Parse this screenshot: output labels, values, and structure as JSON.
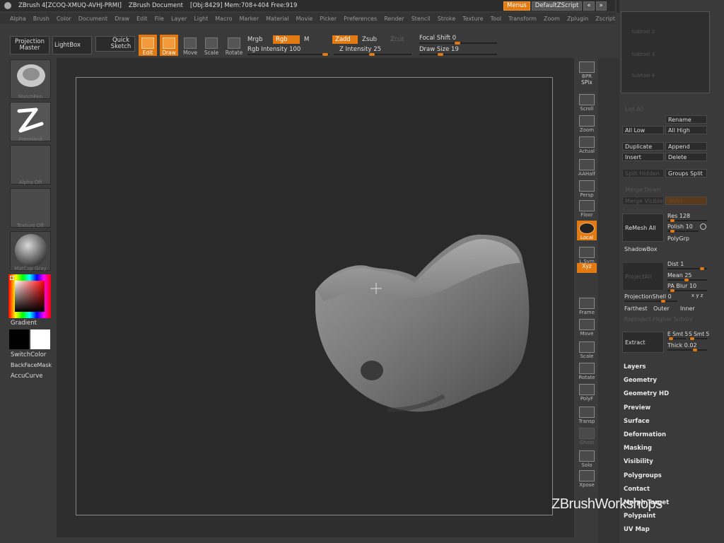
{
  "titlebar": {
    "app_title": "ZBrush 4[ZCOQ-XMUQ-AVHJ-PRMI]",
    "doc_title": "ZBrush Document",
    "stats": "[Obj:8429] Mem:708+404 Free:919",
    "menus_btn": "Menus",
    "script_label": "DefaultZScript",
    "window_buttons": [
      "⌧",
      "▣",
      "🔒",
      "⤓",
      "⧉",
      "✕"
    ]
  },
  "menubar": [
    "Alpha",
    "Brush",
    "Color",
    "Document",
    "Draw",
    "Edit",
    "File",
    "Layer",
    "Light",
    "Macro",
    "Marker",
    "Material",
    "Movie",
    "Picker",
    "Preferences",
    "Render",
    "Stencil",
    "Stroke",
    "Texture",
    "Tool",
    "Transform",
    "Zoom",
    "Zplugin",
    "Zscript"
  ],
  "shelf": {
    "projection_master": "Projection Master",
    "lightbox": "LightBox",
    "quick_sketch": "Quick Sketch",
    "edit": "Edit",
    "draw": "Draw",
    "move": "Move",
    "scale": "Scale",
    "rotate": "Rotate",
    "mrgb": "Mrgb",
    "rgb": "Rgb",
    "m": "M",
    "rgb_intensity": "Rgb Intensity 100",
    "zadd": "Zadd",
    "zsub": "Zsub",
    "zcut": "Zcut",
    "z_intensity": "Z Intensity 25",
    "focal_shift": "Focal Shift 0",
    "draw_size": "Draw Size 19"
  },
  "leftpanel": {
    "brush_caption": "MatchPen",
    "stroke_caption": "FreeHand",
    "alpha_caption": "Alpha Off",
    "texture_caption": "Texture Off",
    "material_caption": "MatCap Gray",
    "gradient": "Gradient",
    "switchcolor": "SwitchColor",
    "backfacemask": "BackFaceMask",
    "accucurve": "AccuCurve"
  },
  "rightstrip": [
    {
      "name": "bpr",
      "label": "BPR"
    },
    {
      "name": "spix",
      "label": "SPix"
    },
    {
      "name": "scroll",
      "label": "Scroll"
    },
    {
      "name": "zoom",
      "label": "Zoom"
    },
    {
      "name": "actual",
      "label": "Actual"
    },
    {
      "name": "aahalf",
      "label": "AAHalf"
    },
    {
      "name": "persp",
      "label": "Persp"
    },
    {
      "name": "floor",
      "label": "Floor"
    },
    {
      "name": "local",
      "label": "Local"
    },
    {
      "name": "lsym",
      "label": "L.Sym"
    },
    {
      "name": "xyz",
      "label": "Xyz"
    },
    {
      "name": "frame",
      "label": "Frame"
    },
    {
      "name": "move",
      "label": "Move"
    },
    {
      "name": "scale",
      "label": "Scale"
    },
    {
      "name": "rotate",
      "label": "Rotate"
    },
    {
      "name": "polyf",
      "label": "PolyF"
    },
    {
      "name": "transp",
      "label": "Transp"
    },
    {
      "name": "ghost",
      "label": "Ghost"
    },
    {
      "name": "solo",
      "label": "Solo"
    },
    {
      "name": "xpose",
      "label": "Xpose"
    }
  ],
  "subtool": {
    "list_items": [
      "Subtool 2",
      "Subtool 3",
      "Subtool 4"
    ],
    "list_all": "List All",
    "rename": "Rename",
    "all_low": "All Low",
    "all_high": "All High",
    "duplicate": "Duplicate",
    "append": "Append",
    "insert": "Insert",
    "delete": "Delete",
    "split_hidden": "Split Hidden",
    "groups_split": "Groups Split",
    "merge_down": "Merge Down",
    "merge_visible": "Merge Visible",
    "weld": "Weld",
    "remesh_all": "ReMesh All",
    "res": "Res 128",
    "polish": "Polish 10",
    "polygrp": "PolyGrp",
    "shadowbox": "ShadowBox",
    "project_all": "ProjectAll",
    "dist": "Dist 1",
    "mean": "Mean 25",
    "pa_blur": "PA Blur 10",
    "projection_shell": "ProjectionShell 0",
    "farthest": "Farthest",
    "outer": "Outer",
    "inner": "Inner",
    "reproject": "Reproject Higher Subdiv",
    "extract": "Extract",
    "e_smt": "E Smt 5",
    "s_smt": "S Smt 5",
    "thick": "Thick 0.02"
  },
  "tool_menus": [
    "Layers",
    "Geometry",
    "Geometry HD",
    "Preview",
    "Surface",
    "Deformation",
    "Masking",
    "Visibility",
    "Polygroups",
    "Contact",
    "Morph Target",
    "Polypaint",
    "UV Map"
  ],
  "watermark": "ZBrushWorkshops"
}
